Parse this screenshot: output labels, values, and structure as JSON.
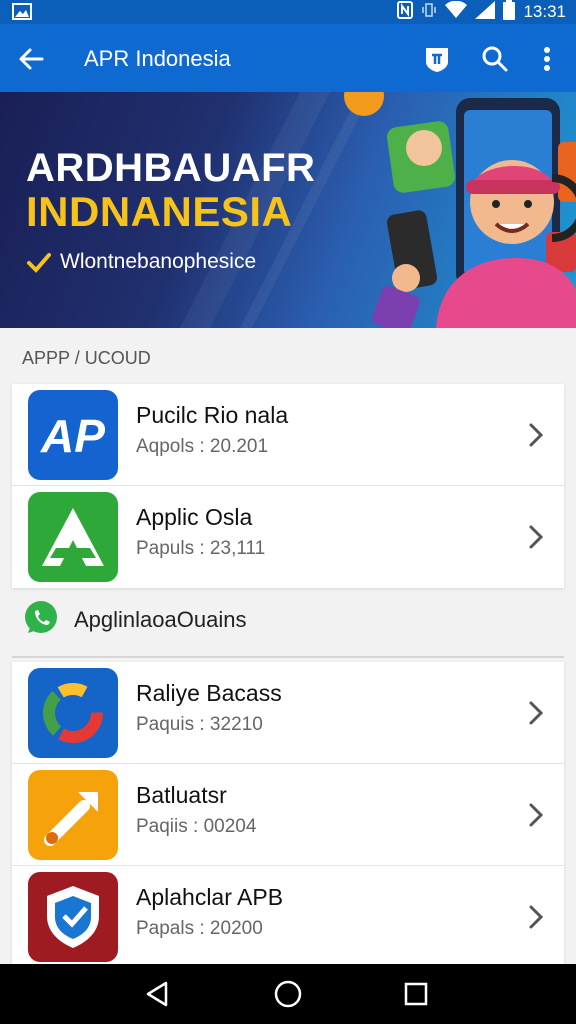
{
  "status_bar": {
    "time": "13:31"
  },
  "app_bar": {
    "title": "APR Indonesia"
  },
  "banner": {
    "title_line1": "ARDHBAUAFR",
    "title_line2": "INDNANESIA",
    "subtitle": "Wlontnebanophesice",
    "colors": {
      "title_line2": "#f6c31b"
    }
  },
  "section1": {
    "label": "APPP / UCOUD",
    "items": [
      {
        "name": "Pucilc Rio nala",
        "meta": "Aqpols : 20.201",
        "icon": "ap-logo-icon"
      },
      {
        "name": "Applic Osla",
        "meta": "Papuls : 23,111",
        "icon": "a-logo-icon"
      }
    ]
  },
  "section2": {
    "label": "ApglinlaoaOuains",
    "icon": "whatsapp-icon",
    "items": [
      {
        "name": "Raliye Bacass",
        "meta": "Paquis : 32210",
        "icon": "ring-logo-icon"
      },
      {
        "name": "Batluatsr",
        "meta": "Paqiis : 00204",
        "icon": "tool-logo-icon"
      },
      {
        "name": "Aplahclar APB",
        "meta": "Papals : 20200",
        "icon": "shield-logo-icon"
      }
    ]
  },
  "colors": {
    "primary": "#0e6ad0",
    "status_bar": "#0b5fb8",
    "background": "#f2f2f2"
  }
}
